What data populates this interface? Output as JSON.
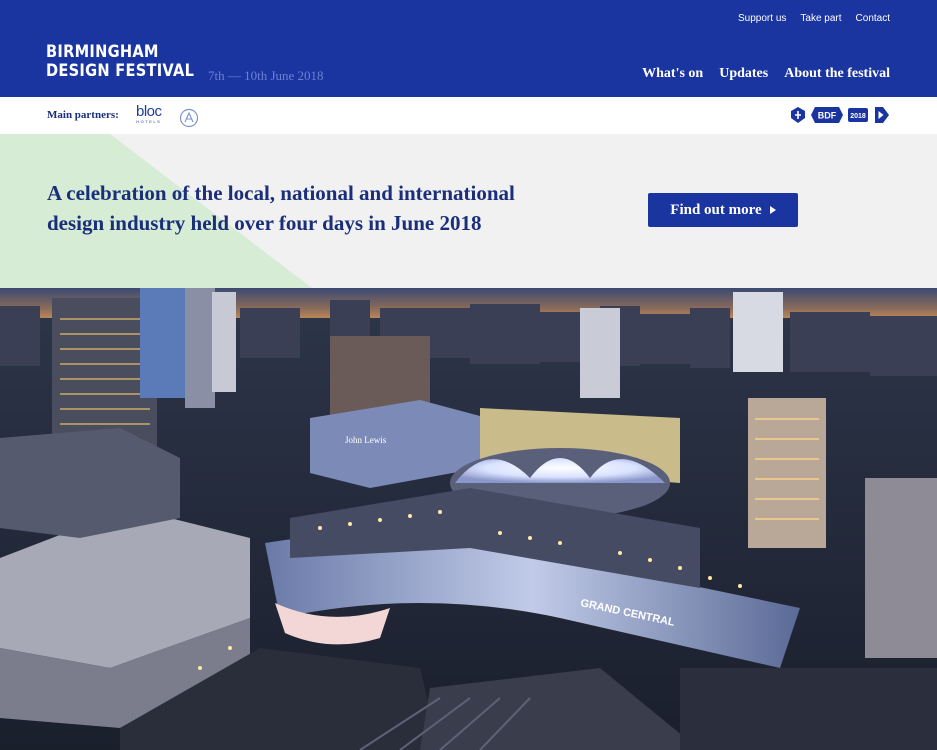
{
  "header": {
    "utility_nav": [
      "Support us",
      "Take part",
      "Contact"
    ],
    "logo_line1": "BIRMINGHAM",
    "logo_line2": "DESIGN FESTIVAL",
    "dates": "7th — 10th June 2018",
    "main_nav": [
      "What's on",
      "Updates",
      "About the festival"
    ]
  },
  "partners": {
    "label": "Main partners:",
    "bloc_word": "bloc",
    "bloc_sub": "HOTELS",
    "badge_text": "BDF",
    "year_text": "2018"
  },
  "hero": {
    "headline": "A celebration of the local, national and international design industry held over four days in June 2018",
    "cta_label": "Find out more"
  },
  "photo": {
    "sign_text": "GRAND CENTRAL",
    "store_text": "John Lewis"
  },
  "colors": {
    "brand_blue": "#1a35a0",
    "navy_text": "#1a2e7a",
    "hero_bg": "#f1f1f1",
    "triangle_green": "#d7ecd5"
  }
}
